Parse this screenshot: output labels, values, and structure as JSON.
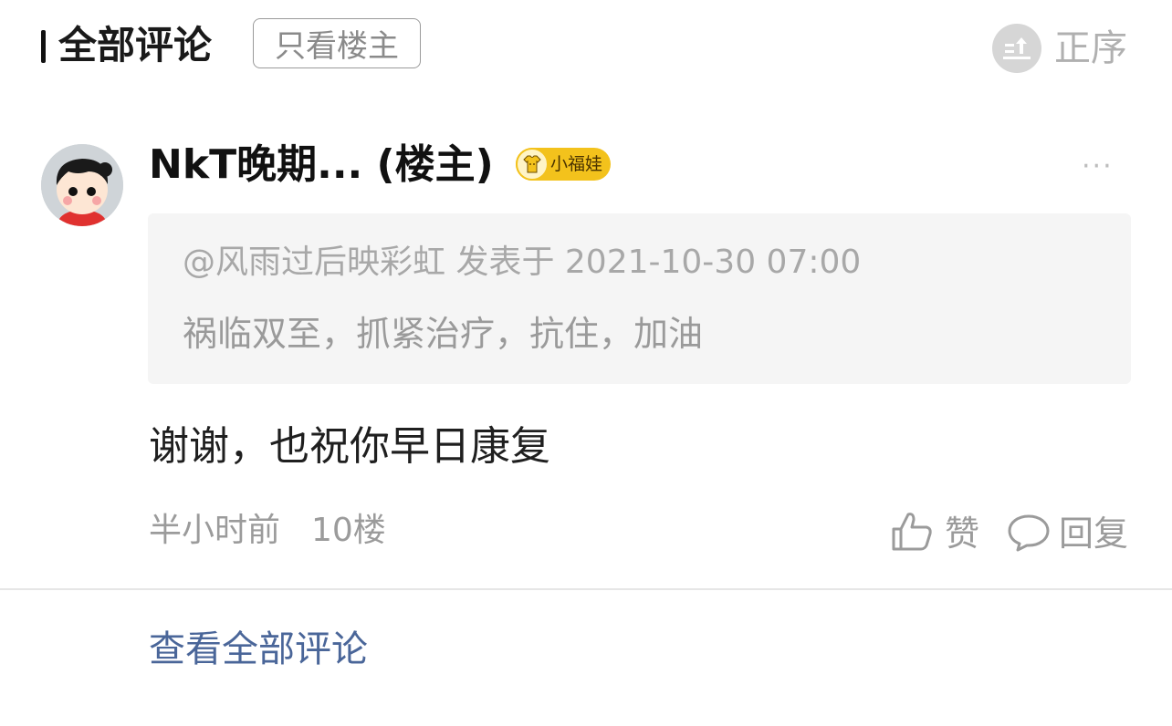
{
  "header": {
    "title": "全部评论",
    "only_op_label": "只看楼主",
    "sort_label": "正序"
  },
  "comment": {
    "username": "NkT晚期... (楼主)",
    "badge_label": "小福娃",
    "more_label": "···",
    "quote": {
      "meta": "@风雨过后映彩虹 发表于 2021-10-30 07:00",
      "text": "祸临双至，抓紧治疗，抗住，加油"
    },
    "content": "谢谢，也祝你早日康复",
    "time": "半小时前",
    "floor": "10楼",
    "like_label": "赞",
    "reply_label": "回复"
  },
  "footer": {
    "view_all_label": "查看全部评论"
  },
  "colors": {
    "badge": "#f3c21c",
    "link": "#4a6699",
    "muted": "#9b9b9b"
  },
  "icons": {
    "sort": "sort-icon",
    "avatar": "avatar",
    "badge": "shirt-icon",
    "like": "thumbs-up-icon",
    "reply": "speech-bubble-icon"
  }
}
